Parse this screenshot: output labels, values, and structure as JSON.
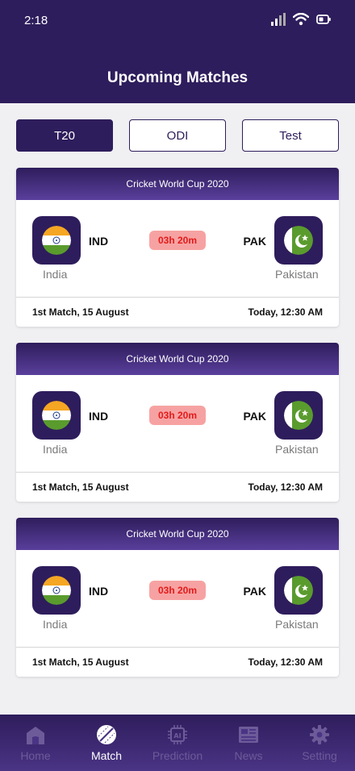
{
  "status_bar": {
    "time": "2:18"
  },
  "header": {
    "title": "Upcoming Matches"
  },
  "tabs": [
    {
      "label": "T20",
      "active": true
    },
    {
      "label": "ODI",
      "active": false
    },
    {
      "label": "Test",
      "active": false
    }
  ],
  "matches": [
    {
      "tournament": "Cricket World Cup 2020",
      "team1": {
        "code": "IND",
        "name": "India",
        "flag": "india-flag-icon"
      },
      "team2": {
        "code": "PAK",
        "name": "Pakistan",
        "flag": "pakistan-flag-icon"
      },
      "countdown": "03h 20m",
      "match_info": "1st Match, 15 August",
      "match_time": "Today, 12:30 AM"
    },
    {
      "tournament": "Cricket World Cup 2020",
      "team1": {
        "code": "IND",
        "name": "India",
        "flag": "india-flag-icon"
      },
      "team2": {
        "code": "PAK",
        "name": "Pakistan",
        "flag": "pakistan-flag-icon"
      },
      "countdown": "03h 20m",
      "match_info": "1st Match, 15 August",
      "match_time": "Today, 12:30 AM"
    },
    {
      "tournament": "Cricket World Cup 2020",
      "team1": {
        "code": "IND",
        "name": "India",
        "flag": "india-flag-icon"
      },
      "team2": {
        "code": "PAK",
        "name": "Pakistan",
        "flag": "pakistan-flag-icon"
      },
      "countdown": "03h 20m",
      "match_info": "1st Match, 15 August",
      "match_time": "Today, 12:30 AM"
    }
  ],
  "bottom_nav": [
    {
      "label": "Home",
      "icon": "home-icon",
      "active": false
    },
    {
      "label": "Match",
      "icon": "cricket-ball-icon",
      "active": true
    },
    {
      "label": "Prediction",
      "icon": "ai-chip-icon",
      "active": false
    },
    {
      "label": "News",
      "icon": "newspaper-icon",
      "active": false
    },
    {
      "label": "Setting",
      "icon": "gear-icon",
      "active": false
    }
  ],
  "colors": {
    "primary": "#2e1d5c",
    "countdown_bg": "#f7a2a2",
    "countdown_text": "#e21b1b",
    "india_saffron": "#f5a623",
    "india_green": "#5a9b2e",
    "pakistan_green": "#5a9b2e"
  }
}
